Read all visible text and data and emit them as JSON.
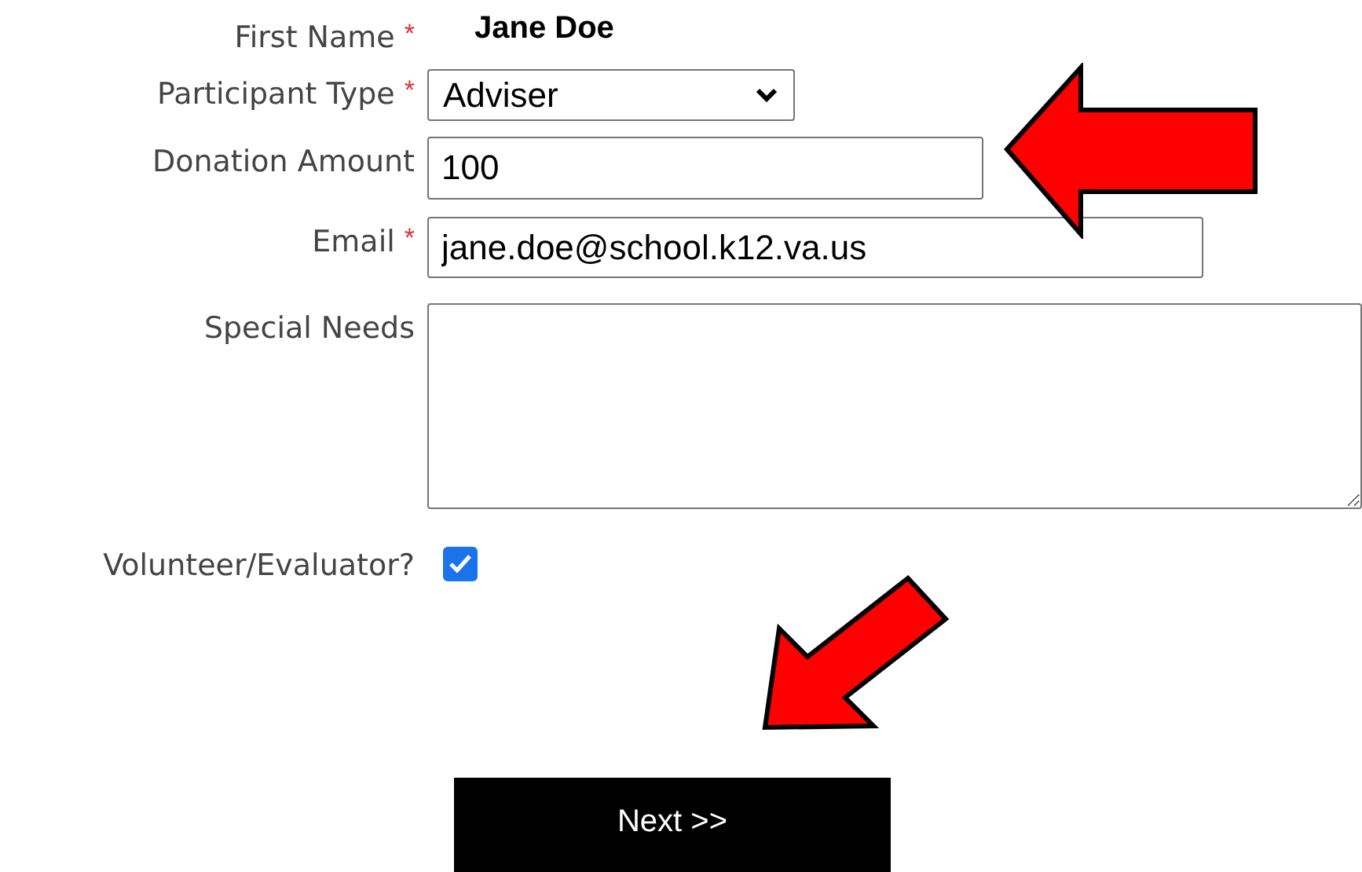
{
  "required_marker": "*",
  "fields": [
    {
      "kind": "static",
      "label": "First Name",
      "required": true,
      "value": "Jane Doe"
    },
    {
      "kind": "select",
      "label": "Participant Type",
      "required": true,
      "value": "Adviser"
    },
    {
      "kind": "text",
      "label": "Donation Amount",
      "required": false,
      "value": "100"
    },
    {
      "kind": "text",
      "label": "Email",
      "required": true,
      "value": "jane.doe@school.k12.va.us"
    },
    {
      "kind": "textarea",
      "label": "Special Needs",
      "required": false
    },
    {
      "kind": "checkbox",
      "label": "Volunteer/Evaluator?",
      "checked": true
    }
  ],
  "button": {
    "label": "Next >>"
  }
}
